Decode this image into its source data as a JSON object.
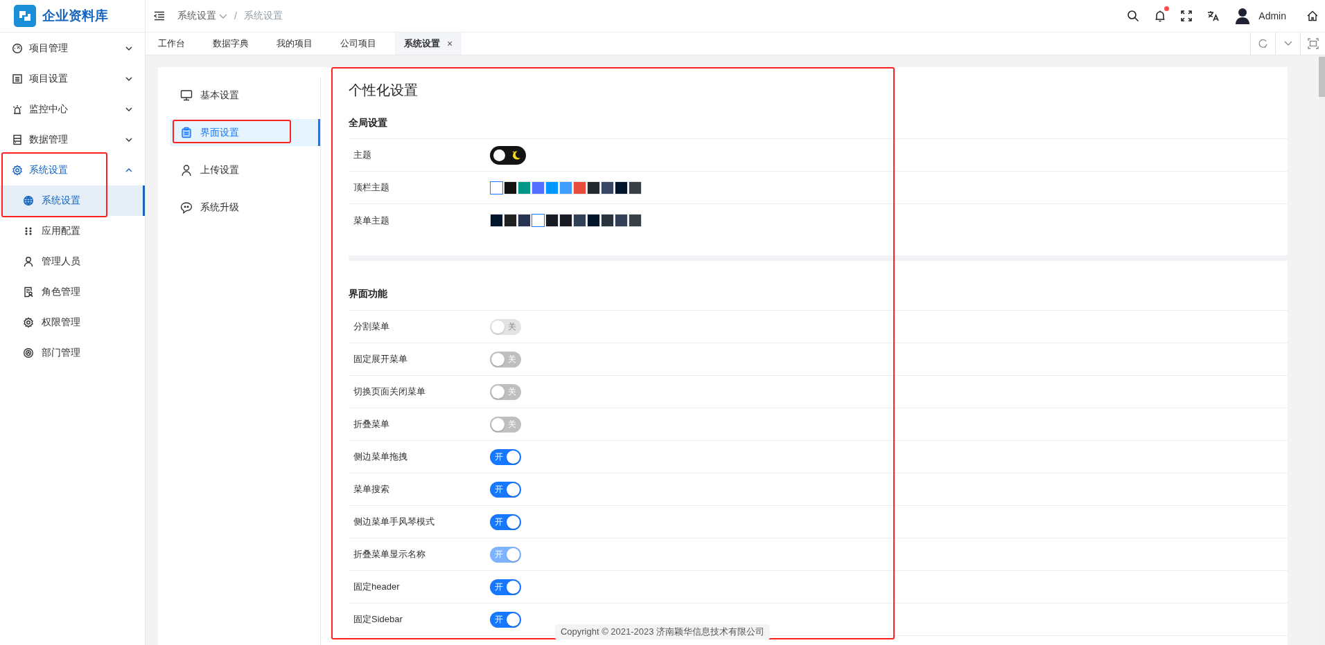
{
  "app": {
    "title": "企业资料库"
  },
  "header": {
    "separator": "/",
    "breadcrumb": [
      {
        "label": "系统设置",
        "dropdown": true
      },
      {
        "label": "系统设置",
        "dropdown": false
      }
    ],
    "has_unread": true,
    "user": "Admin"
  },
  "tabs": [
    {
      "label": "工作台",
      "selected": false,
      "closable": false
    },
    {
      "label": "数据字典",
      "selected": false,
      "closable": false
    },
    {
      "label": "我的项目",
      "selected": false,
      "closable": false
    },
    {
      "label": "公司项目",
      "selected": false,
      "closable": false
    },
    {
      "label": "系统设置",
      "selected": true,
      "closable": true,
      "close": "×"
    }
  ],
  "sidebar": {
    "items": [
      {
        "label": "项目管理",
        "expanded": false,
        "selected": false,
        "highlighted": false
      },
      {
        "label": "项目设置",
        "expanded": false,
        "selected": false,
        "highlighted": false
      },
      {
        "label": "监控中心",
        "expanded": false,
        "selected": false,
        "highlighted": false
      },
      {
        "label": "数据管理",
        "expanded": false,
        "selected": false,
        "highlighted": false
      },
      {
        "label": "系统设置",
        "expanded": true,
        "selected": true,
        "highlighted": true,
        "children": [
          {
            "label": "系统设置",
            "selected": true
          },
          {
            "label": "应用配置",
            "selected": false
          },
          {
            "label": "管理人员",
            "selected": false
          },
          {
            "label": "角色管理",
            "selected": false
          },
          {
            "label": "权限管理",
            "selected": false
          },
          {
            "label": "部门管理",
            "selected": false
          }
        ]
      }
    ]
  },
  "settings_menu": {
    "items": [
      {
        "label": "基本设置",
        "selected": false,
        "highlighted": false
      },
      {
        "label": "界面设置",
        "selected": true,
        "highlighted": true
      },
      {
        "label": "上传设置",
        "selected": false,
        "highlighted": false
      },
      {
        "label": "系统升级",
        "selected": false,
        "highlighted": false
      }
    ]
  },
  "panel": {
    "title": "个性化设置",
    "highlighted": true,
    "sections": [
      {
        "heading": "全局设置",
        "rows": [
          {
            "kind": "theme_switch",
            "label": "主题",
            "on": false
          },
          {
            "kind": "swatches",
            "label": "顶栏主题",
            "swatches": [
              {
                "color": "#ffffff",
                "selected": true
              },
              {
                "color": "#141414",
                "selected": false
              },
              {
                "color": "#009688",
                "selected": false
              },
              {
                "color": "#536dfe",
                "selected": false
              },
              {
                "color": "#0096ff",
                "selected": false
              },
              {
                "color": "#409eff",
                "selected": false
              },
              {
                "color": "#e74c3c",
                "selected": false
              },
              {
                "color": "#24292e",
                "selected": false
              },
              {
                "color": "#394664",
                "selected": false
              },
              {
                "color": "#001529",
                "selected": false
              },
              {
                "color": "#383f45",
                "selected": false
              }
            ]
          },
          {
            "kind": "swatches",
            "label": "菜单主题",
            "swatches": [
              {
                "color": "#001529",
                "selected": false
              },
              {
                "color": "#212121",
                "selected": false
              },
              {
                "color": "#273352",
                "selected": false
              },
              {
                "color": "#ffffff",
                "selected": true
              },
              {
                "color": "#191b24",
                "selected": false
              },
              {
                "color": "#191a23",
                "selected": false
              },
              {
                "color": "#304156",
                "selected": false
              },
              {
                "color": "#001628",
                "selected": false
              },
              {
                "color": "#28333e",
                "selected": false
              },
              {
                "color": "#344058",
                "selected": false
              },
              {
                "color": "#383f45",
                "selected": false
              }
            ]
          }
        ]
      },
      {
        "heading": "界面功能",
        "rows": [
          {
            "kind": "toggle",
            "label": "分割菜单",
            "on": false,
            "disabled": true,
            "text": "关"
          },
          {
            "kind": "toggle",
            "label": "固定展开菜单",
            "on": false,
            "disabled": false,
            "text": "关"
          },
          {
            "kind": "toggle",
            "label": "切换页面关闭菜单",
            "on": false,
            "disabled": false,
            "text": "关"
          },
          {
            "kind": "toggle",
            "label": "折叠菜单",
            "on": false,
            "disabled": false,
            "text": "关"
          },
          {
            "kind": "toggle",
            "label": "侧边菜单拖拽",
            "on": true,
            "disabled": false,
            "text": "开"
          },
          {
            "kind": "toggle",
            "label": "菜单搜索",
            "on": true,
            "disabled": false,
            "text": "开"
          },
          {
            "kind": "toggle",
            "label": "侧边菜单手风琴模式",
            "on": true,
            "disabled": false,
            "text": "开"
          },
          {
            "kind": "toggle",
            "label": "折叠菜单显示名称",
            "on": true,
            "disabled": true,
            "text": "开"
          },
          {
            "kind": "toggle",
            "label": "固定header",
            "on": true,
            "disabled": false,
            "text": "开"
          },
          {
            "kind": "toggle",
            "label": "固定Sidebar",
            "on": true,
            "disabled": false,
            "text": "开"
          }
        ]
      }
    ]
  },
  "footer": {
    "copyright": "Copyright © 2021-2023 济南颖华信息技术有限公司"
  }
}
